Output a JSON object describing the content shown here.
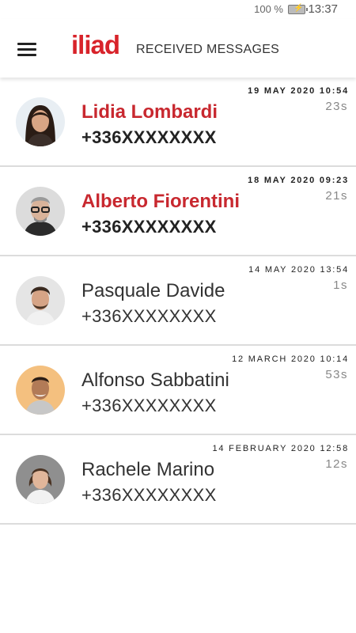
{
  "status": {
    "battery_pct": "100 %",
    "time": "13:37",
    "battery_icon": "battery-charging-icon"
  },
  "appbar": {
    "logo": "iliad",
    "title": "RECEIVED MESSAGES",
    "menu_icon": "hamburger-menu-icon"
  },
  "colors": {
    "brand": "#d8232a",
    "unread_name": "#c8282f"
  },
  "messages": [
    {
      "name": "Lidia Lombardi",
      "number": "+336XXXXXXXX",
      "date": "19 MAY 2020 10:54",
      "duration": "23s",
      "unread": true
    },
    {
      "name": "Alberto Fiorentini",
      "number": "+336XXXXXXXX",
      "date": "18 MAY 2020 09:23",
      "duration": "21s",
      "unread": true
    },
    {
      "name": "Pasquale Davide",
      "number": "+336XXXXXXXX",
      "date": "14 MAY 2020 13:54",
      "duration": "1s",
      "unread": false
    },
    {
      "name": "Alfonso Sabbatini",
      "number": "+336XXXXXXXX",
      "date": "12 MARCH 2020 10:14",
      "duration": "53s",
      "unread": false
    },
    {
      "name": "Rachele Marino",
      "number": "+336XXXXXXXX",
      "date": "14 FEBRUARY 2020 12:58",
      "duration": "12s",
      "unread": false
    }
  ]
}
